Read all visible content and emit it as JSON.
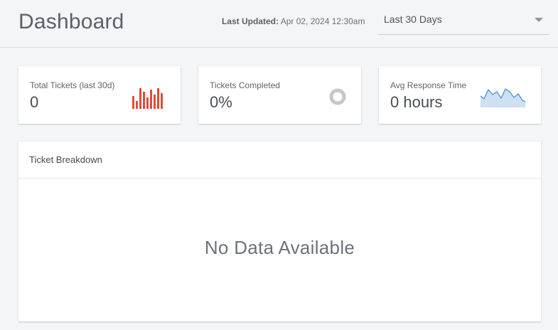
{
  "header": {
    "title": "Dashboard",
    "last_updated_label": "Last Updated:",
    "last_updated_value": "Apr 02, 2024 12:30am",
    "range_select": {
      "selected": "Last 30 Days",
      "icon": "chevron-down-icon"
    }
  },
  "cards": [
    {
      "label": "Total Tickets (last 30d)",
      "value": "0",
      "icon": "bar-chart-icon",
      "color": "#e04b3a"
    },
    {
      "label": "Tickets Completed",
      "value": "0%",
      "icon": "donut-chart-icon",
      "color": "#c3c6ca"
    },
    {
      "label": "Avg Response Time",
      "value": "0 hours",
      "icon": "area-chart-icon",
      "color": "#4a90d9"
    }
  ],
  "breakdown": {
    "title": "Ticket Breakdown",
    "empty_message": "No Data Available"
  }
}
